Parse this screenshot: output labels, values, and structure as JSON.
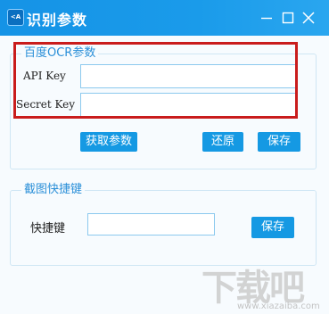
{
  "window": {
    "title": "识别参数",
    "icon_text": "<A"
  },
  "baidu_group": {
    "legend": "百度OCR参数",
    "api_key_label": "API Key",
    "api_key_value": "",
    "secret_key_label": "Secret Key",
    "secret_key_value": "",
    "get_params_button": "获取参数",
    "restore_button": "还原",
    "save_button": "保存"
  },
  "hotkey_group": {
    "legend": "截图快捷键",
    "hotkey_label": "快捷键",
    "hotkey_value": "",
    "save_button": "保存"
  },
  "watermark": {
    "text": "下载吧",
    "url": "www.xiazaiba.com"
  },
  "colors": {
    "titlebar": "#1593e6",
    "accent": "#1599e3",
    "highlight_box": "#c91c1c",
    "group_border": "#cfe6f4"
  },
  "icons": [
    "app-icon",
    "minimize-icon",
    "maximize-icon",
    "close-icon"
  ]
}
